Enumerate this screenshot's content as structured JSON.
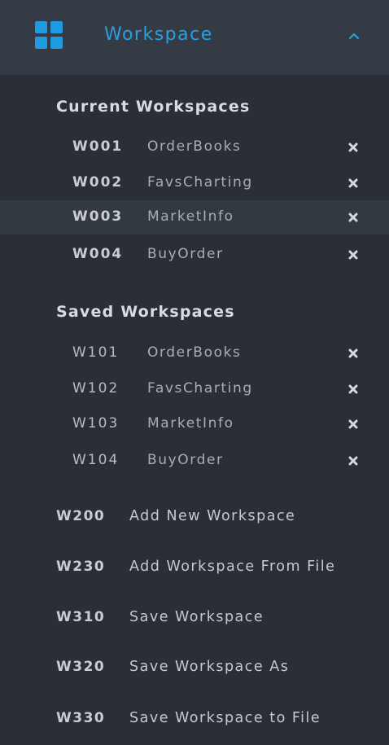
{
  "header": {
    "title": "Workspace",
    "icon": "grid-icon",
    "toggle_icon": "chevron-up-icon",
    "accent_color": "#1e9be0"
  },
  "current": {
    "title": "Current Workspaces",
    "items": [
      {
        "code": "W001",
        "name": "OrderBooks",
        "selected": false
      },
      {
        "code": "W002",
        "name": "FavsCharting",
        "selected": false
      },
      {
        "code": "W003",
        "name": "MarketInfo",
        "selected": true
      },
      {
        "code": "W004",
        "name": "BuyOrder",
        "selected": false
      }
    ]
  },
  "saved": {
    "title": "Saved Workspaces",
    "items": [
      {
        "code": "W101",
        "name": "OrderBooks"
      },
      {
        "code": "W102",
        "name": "FavsCharting"
      },
      {
        "code": "W103",
        "name": "MarketInfo"
      },
      {
        "code": "W104",
        "name": "BuyOrder"
      }
    ]
  },
  "actions": [
    {
      "code": "W200",
      "label": "Add New Workspace"
    },
    {
      "code": "W230",
      "label": "Add Workspace From File"
    },
    {
      "code": "W310",
      "label": "Save Workspace"
    },
    {
      "code": "W320",
      "label": "Save Workspace As"
    },
    {
      "code": "W330",
      "label": "Save Workspace to File"
    }
  ]
}
